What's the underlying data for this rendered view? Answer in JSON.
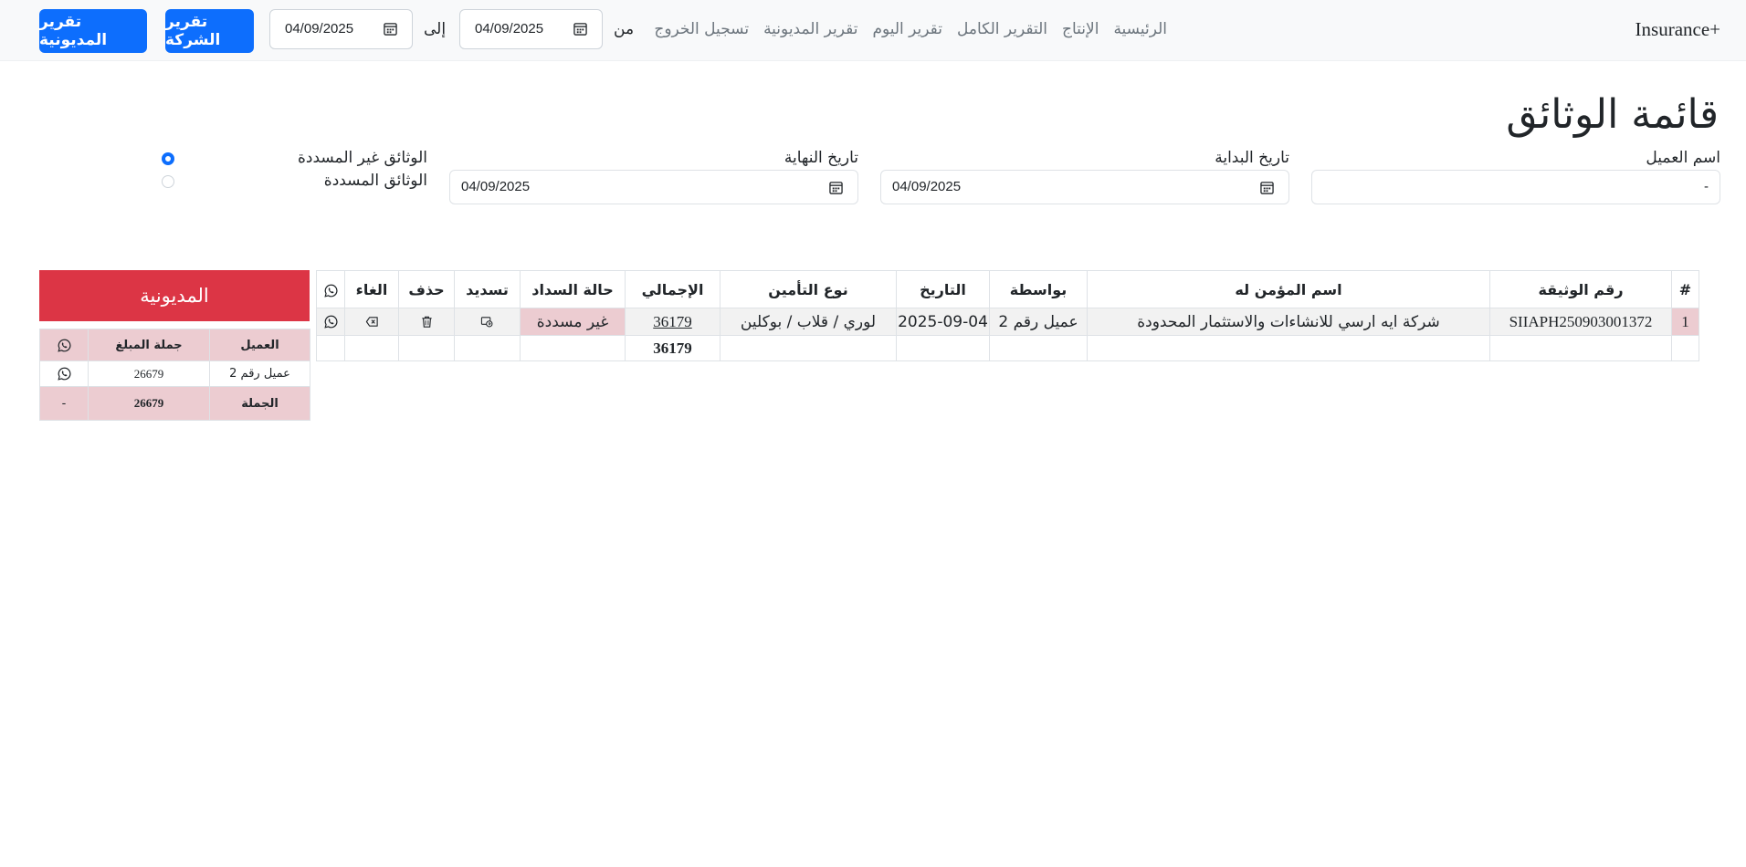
{
  "navbar": {
    "brand": "Insurance+",
    "links": [
      "الرئيسية",
      "الإنتاج",
      "التقرير الكامل",
      "تقرير اليوم",
      "تقرير المديونية",
      "تسجيل الخروج"
    ],
    "from_label": "من",
    "from_date": "04/09/2025",
    "to_label": "إلى",
    "to_date": "04/09/2025",
    "company_report_button": "تقرير الشركة",
    "debt_report_button": "تقرير المديونية"
  },
  "page_title": "قائمة الوثائق",
  "filters": {
    "client_label": "اسم العميل",
    "client_value": "-",
    "start_label": "تاريخ البداية",
    "start_value": "04/09/2025",
    "end_label": "تاريخ النهاية",
    "end_value": "04/09/2025",
    "unpaid_label": "الوثائق غير المسددة",
    "paid_label": "الوثائق المسددة",
    "selected": "unpaid"
  },
  "policies_table": {
    "headers": [
      "#",
      "رقم الوثيقة",
      "اسم المؤمن له",
      "بواسطة",
      "التاريخ",
      "نوع التأمين",
      "الإجمالي",
      "حالة السداد",
      "تسديد",
      "حذف",
      "الغاء",
      "whatsapp-icon"
    ],
    "rows": [
      {
        "index": "1",
        "policy_no": "SIIAPH250903001372",
        "insured_name": "شركة ايه ارسي للانشاءات والاستثمار المحدودة",
        "by": "عميل رقم 2",
        "date": "2025-09-04",
        "insurance_type": "لوري / قلاب / بوكلين",
        "total": "36179",
        "status": "غير مسددة"
      }
    ],
    "footer_total": "36179"
  },
  "debt_panel": {
    "title": "المديونية",
    "headers": [
      "العميل",
      "جملة المبلغ",
      "whatsapp-icon"
    ],
    "rows": [
      {
        "client": "عميل رقم 2",
        "amount": "26679"
      }
    ],
    "total_label": "الجملة",
    "total_amount": "26679",
    "total_extra": "-"
  },
  "colors": {
    "primary": "#0d6efd",
    "danger": "#dc3545",
    "pink": "#ecccd1",
    "navbar_bg": "#f8f9fa"
  }
}
